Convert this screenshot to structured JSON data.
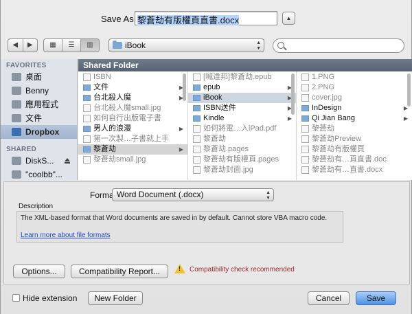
{
  "save_as": {
    "label": "Save As:",
    "filename": "黎蒼劫有版權頁直書.docx"
  },
  "toolbar": {
    "location": "iBook",
    "search_placeholder": ""
  },
  "sidebar": {
    "favorites_title": "FAVORITES",
    "favorites": [
      "桌面",
      "Benny",
      "應用程式",
      "文件",
      "Dropbox"
    ],
    "selected": "Dropbox",
    "shared_title": "SHARED",
    "shared": [
      "DiskS...",
      "\"coolbb\"..."
    ]
  },
  "browser": {
    "title": "Shared Folder",
    "col1": [
      {
        "name": "ISBN",
        "type": "file",
        "dim": true
      },
      {
        "name": "文件",
        "type": "folder"
      },
      {
        "name": "台北殺人魔",
        "type": "folder"
      },
      {
        "name": "台北殺人魔small.jpg",
        "type": "file",
        "dim": true
      },
      {
        "name": "如何自行出版電子書",
        "type": "file",
        "dim": true
      },
      {
        "name": "男人的浪漫",
        "type": "folder"
      },
      {
        "name": "第一次製…子書就上手",
        "type": "file",
        "dim": true
      },
      {
        "name": "黎蒼劫",
        "type": "folder",
        "selected": true
      },
      {
        "name": "黎蒼劫small.jpg",
        "type": "file",
        "dim": true
      }
    ],
    "col2": [
      {
        "name": "[喊違邦]黎蒼劫.epub",
        "type": "file",
        "dim": true
      },
      {
        "name": "epub",
        "type": "folder"
      },
      {
        "name": "iBook",
        "type": "folder",
        "selected": true
      },
      {
        "name": "ISBN送件",
        "type": "folder"
      },
      {
        "name": "Kindle",
        "type": "folder"
      },
      {
        "name": "如何將電…入iPad.pdf",
        "type": "file",
        "dim": true
      },
      {
        "name": "黎蒼劫",
        "type": "file",
        "dim": true
      },
      {
        "name": "黎蒼劫.pages",
        "type": "file",
        "dim": true
      },
      {
        "name": "黎蒼劫有版權頁.pages",
        "type": "file",
        "dim": true
      },
      {
        "name": "黎蒼劫封面.jpg",
        "type": "file",
        "dim": true
      }
    ],
    "col3": [
      {
        "name": "1.PNG",
        "type": "file",
        "dim": true
      },
      {
        "name": "2.PNG",
        "type": "file",
        "dim": true
      },
      {
        "name": "cover.jpg",
        "type": "file",
        "dim": true
      },
      {
        "name": "InDesign",
        "type": "folder"
      },
      {
        "name": "Qi Jian Bang",
        "type": "folder"
      },
      {
        "name": "黎蒼劫",
        "type": "file",
        "dim": true
      },
      {
        "name": "黎蒼劫Preview",
        "type": "file",
        "dim": true
      },
      {
        "name": "黎蒼劫有版權頁",
        "type": "file",
        "dim": true
      },
      {
        "name": "黎蒼劫有…頁直書.doc",
        "type": "file",
        "dim": true
      },
      {
        "name": "黎蒼劫有…直書.docx",
        "type": "file",
        "dim": true
      }
    ]
  },
  "format": {
    "label": "Format:",
    "value": "Word Document (.docx)",
    "description_title": "Description",
    "description": "The XML-based format that Word documents are saved in by default. Cannot store VBA macro code.",
    "link": "Learn more about file formats"
  },
  "buttons": {
    "options": "Options...",
    "compat": "Compatibility Report...",
    "compat_warning": "Compatibility check recommended",
    "hide_extension": "Hide extension",
    "new_folder": "New Folder",
    "cancel": "Cancel",
    "save": "Save"
  }
}
